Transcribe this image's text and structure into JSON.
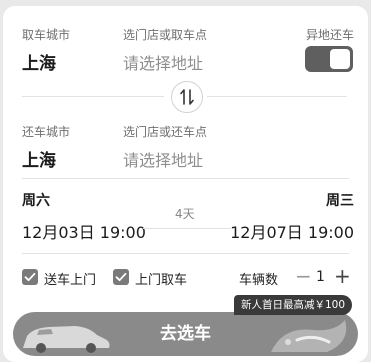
{
  "pickup": {
    "city_label": "取车城市",
    "city": "上海",
    "store_label": "选门店或取车点",
    "store_placeholder": "请选择地址",
    "different_return_label": "异地还车"
  },
  "return": {
    "city_label": "还车城市",
    "city": "上海",
    "store_label": "选门店或还车点",
    "store_placeholder": "请选择地址"
  },
  "dates": {
    "start_weekday": "周六",
    "start_datetime": "12月03日 19:00",
    "duration": "4天",
    "end_weekday": "周三",
    "end_datetime": "12月07日 19:00"
  },
  "options": {
    "delivery_label": "送车上门",
    "delivery_checked": true,
    "pickup_door_label": "上门取车",
    "pickup_door_checked": true,
    "vehicle_count_label": "车辆数",
    "vehicle_count": "1",
    "minus": "−",
    "plus": "+"
  },
  "promo_badge": "新人首日最高减￥100",
  "cta": {
    "label": "去选车"
  },
  "colors": {
    "toggle_on": "#5f5f5f",
    "cta_bg": "#8a8a8a",
    "checkbox": "#7a7a7a"
  },
  "icons": [
    "swap-icon",
    "check-icon",
    "car-illustration"
  ]
}
